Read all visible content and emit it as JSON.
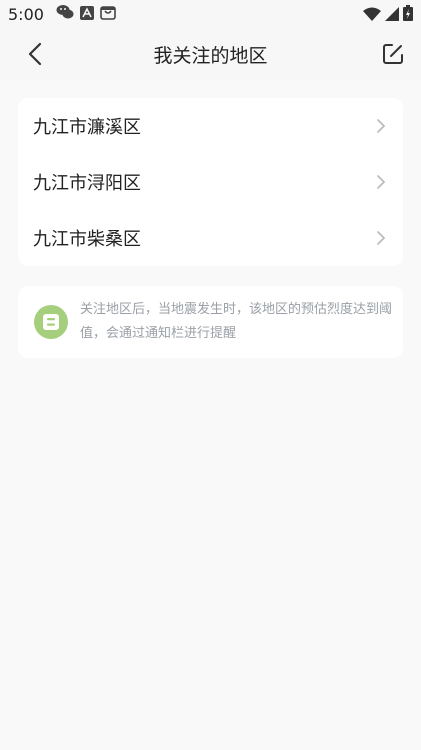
{
  "status_bar": {
    "time": "5:00",
    "left_icons": [
      "wechat-icon",
      "accessibility-icon",
      "shopping-bag-icon"
    ],
    "right_icons": [
      "wifi-icon",
      "signal-icon",
      "battery-icon"
    ]
  },
  "header": {
    "title": "我关注的地区",
    "back_icon": "chevron-left-icon",
    "edit_icon": "edit-icon"
  },
  "regions": [
    {
      "label": "九江市濂溪区"
    },
    {
      "label": "九江市浔阳区"
    },
    {
      "label": "九江市柴桑区"
    }
  ],
  "notice": {
    "icon": "notice-icon",
    "text": "关注地区后，当地震发生时，该地区的预估烈度达到阈值，会通过通知栏进行提醒"
  },
  "colors": {
    "background": "#f7f7f7",
    "card": "#ffffff",
    "notice_icon": "#a5cf7c",
    "notice_text": "#9aa0a6"
  }
}
